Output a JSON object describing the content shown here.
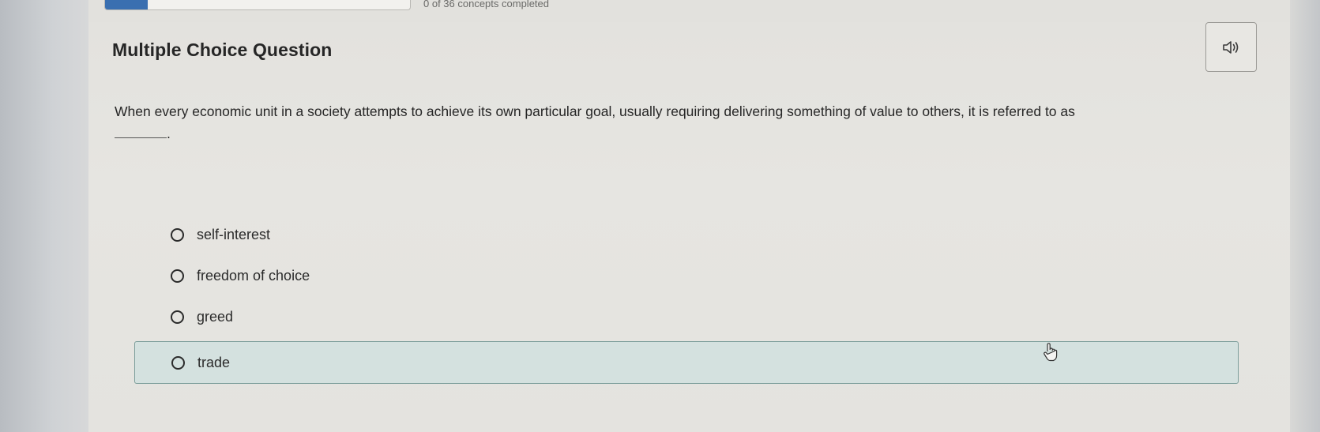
{
  "progress": {
    "fraction": 0.14,
    "status_text": "0 of 36 concepts completed"
  },
  "header": {
    "title": "Multiple Choice Question",
    "audio_icon": "speaker-icon"
  },
  "question": {
    "text": "When every economic unit in a society attempts to achieve its own particular goal, usually requiring delivering something of value to others, it is referred to as",
    "trailing_punct": "."
  },
  "options": [
    {
      "label": "self-interest",
      "selected": false,
      "hovered": false
    },
    {
      "label": "freedom of choice",
      "selected": false,
      "hovered": false
    },
    {
      "label": "greed",
      "selected": false,
      "hovered": false
    },
    {
      "label": "trade",
      "selected": false,
      "hovered": true
    }
  ],
  "colors": {
    "hover_bg": "#d4e1df",
    "hover_border": "#7c9e9b",
    "progress_fill": "#3a6fb0"
  },
  "cursor": "hand-pointer-icon"
}
